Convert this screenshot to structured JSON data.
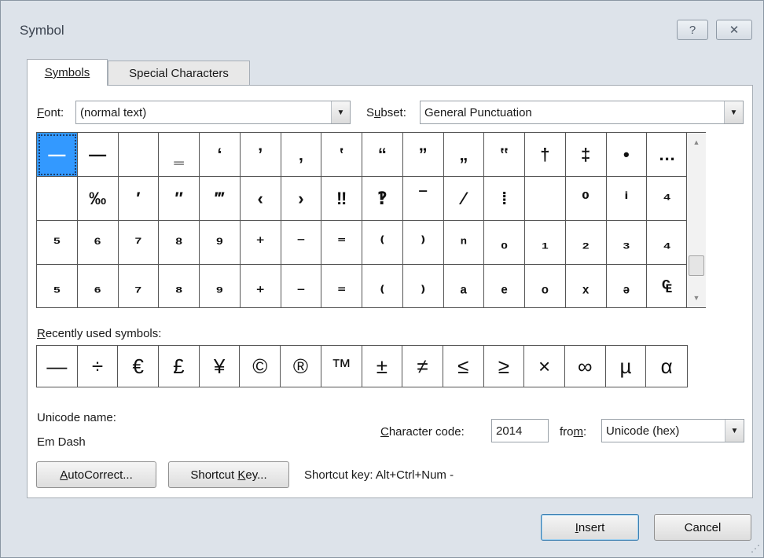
{
  "window": {
    "title": "Symbol",
    "help_label": "?",
    "close_label": "✕"
  },
  "tabs": [
    {
      "label": "Symbols",
      "active": true
    },
    {
      "label": "Special Characters",
      "active": false
    }
  ],
  "font": {
    "label_underlined": "F",
    "label_rest": "ont:",
    "value": "(normal text)"
  },
  "subset": {
    "label_pre": "S",
    "label_underlined": "u",
    "label_rest": "bset:",
    "value": "General Punctuation"
  },
  "symbol_grid": [
    [
      "—",
      "—",
      "",
      "‗",
      "‘",
      "’",
      "‚",
      "‛",
      "“",
      "”",
      "„",
      "‟",
      "†",
      "‡",
      "•",
      "…"
    ],
    [
      "",
      "‰",
      "′",
      "″",
      "‴",
      "‹",
      "›",
      "‼",
      "‽",
      "‾",
      "⁄",
      "⁞",
      "",
      "⁰",
      "ⁱ",
      "⁴"
    ],
    [
      "⁵",
      "⁶",
      "⁷",
      "⁸",
      "⁹",
      "⁺",
      "⁻",
      "⁼",
      "⁽",
      "⁾",
      "ⁿ",
      "₀",
      "₁",
      "₂",
      "₃",
      "₄"
    ],
    [
      "₅",
      "₆",
      "₇",
      "₈",
      "₉",
      "₊",
      "₋",
      "₌",
      "₍",
      "₎",
      "ₐ",
      "ₑ",
      "ₒ",
      "ₓ",
      "ₔ",
      "₠"
    ]
  ],
  "recent": {
    "label_underlined": "R",
    "label_rest": "ecently used symbols:",
    "symbols": [
      "—",
      "÷",
      "€",
      "£",
      "¥",
      "©",
      "®",
      "™",
      "±",
      "≠",
      "≤",
      "≥",
      "×",
      "∞",
      "µ",
      "α"
    ]
  },
  "unicode_name": {
    "label": "Unicode name:",
    "value": "Em Dash"
  },
  "character_code": {
    "label_underlined": "C",
    "label_rest": "haracter code:",
    "value": "2014"
  },
  "from": {
    "label_pre": "fro",
    "label_underlined": "m",
    "label_rest": ":",
    "value": "Unicode (hex)"
  },
  "buttons": {
    "autocorrect_underlined": "A",
    "autocorrect_rest": "utoCorrect...",
    "shortcut_pre": "Shortcut ",
    "shortcut_underlined": "K",
    "shortcut_rest": "ey...",
    "insert_underlined": "I",
    "insert_rest": "nsert",
    "cancel": "Cancel"
  },
  "shortcut_text": "Shortcut key: Alt+Ctrl+Num -"
}
